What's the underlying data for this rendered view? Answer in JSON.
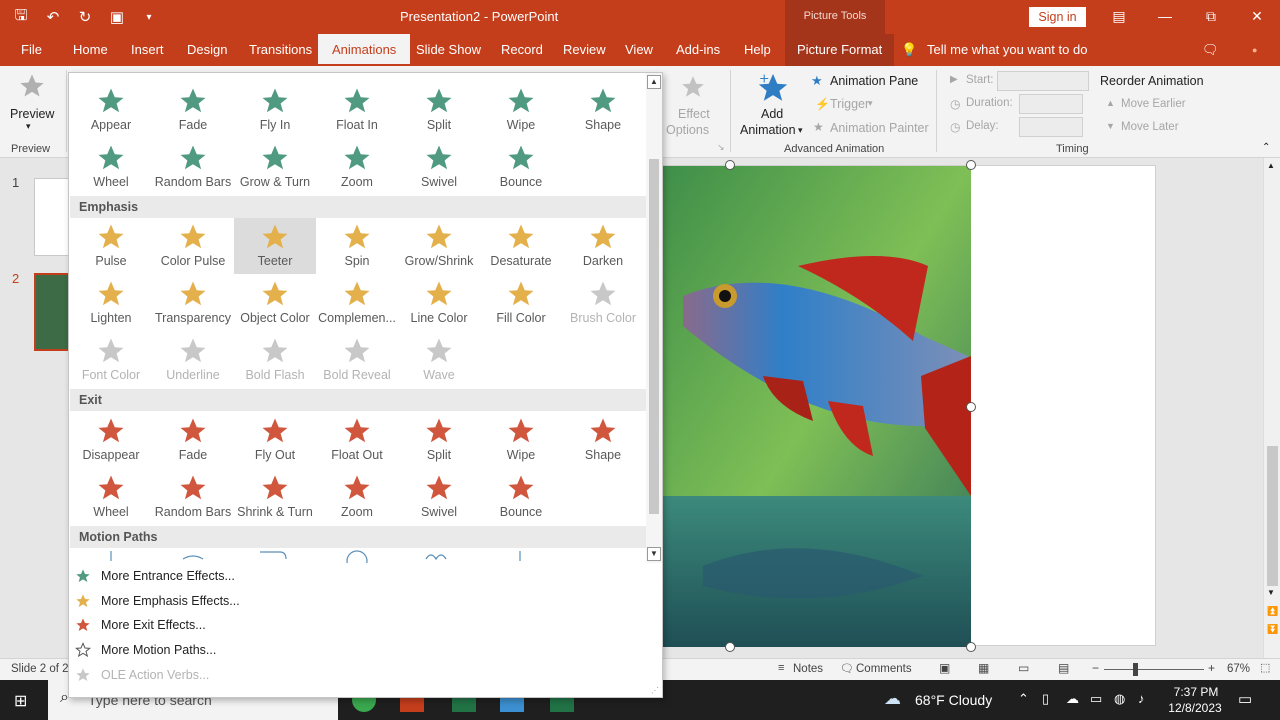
{
  "titlebar": {
    "doc_title": "Presentation2  -  PowerPoint",
    "picture_tools": "Picture Tools",
    "sign_in": "Sign in"
  },
  "tabs": [
    "File",
    "Home",
    "Insert",
    "Design",
    "Transitions",
    "Animations",
    "Slide Show",
    "Record",
    "Review",
    "View",
    "Add-ins",
    "Help",
    "Picture Format"
  ],
  "tell_me": "Tell me what you want to do",
  "ribbon": {
    "preview_label": "Preview",
    "preview_group": "Preview",
    "effect_options_1": "Effect",
    "effect_options_2": "Options",
    "add_animation_1": "Add",
    "add_animation_2": "Animation",
    "animation_pane": "Animation Pane",
    "trigger": "Trigger",
    "animation_painter": "Animation Painter",
    "advanced_group": "Advanced Animation",
    "start": "Start:",
    "duration": "Duration:",
    "delay": "Delay:",
    "timing_group": "Timing",
    "reorder": "Reorder Animation",
    "move_earlier": "Move Earlier",
    "move_later": "Move Later"
  },
  "sections": {
    "emphasis": "Emphasis",
    "exit": "Exit",
    "motion_paths": "Motion Paths"
  },
  "entrance_effects": [
    "Appear",
    "Fade",
    "Fly In",
    "Float In",
    "Split",
    "Wipe",
    "Shape",
    "Wheel",
    "Random Bars",
    "Grow & Turn",
    "Zoom",
    "Swivel",
    "Bounce"
  ],
  "emphasis_effects": [
    "Pulse",
    "Color Pulse",
    "Teeter",
    "Spin",
    "Grow/Shrink",
    "Desaturate",
    "Darken",
    "Lighten",
    "Transparency",
    "Object Color",
    "Complemen...",
    "Line Color",
    "Fill Color",
    "Brush Color",
    "Font Color",
    "Underline",
    "Bold Flash",
    "Bold Reveal",
    "Wave"
  ],
  "exit_effects": [
    "Disappear",
    "Fade",
    "Fly Out",
    "Float Out",
    "Split",
    "Wipe",
    "Shape",
    "Wheel",
    "Random Bars",
    "Shrink & Turn",
    "Zoom",
    "Swivel",
    "Bounce"
  ],
  "more_items": [
    "More Entrance Effects...",
    "More Emphasis Effects...",
    "More Exit Effects...",
    "More Motion Paths...",
    "OLE Action Verbs..."
  ],
  "slides": [
    "1",
    "2"
  ],
  "status": {
    "slide_of": "Slide 2 of 2",
    "notes": "Notes",
    "comments": "Comments",
    "zoom": "67%"
  },
  "taskbar": {
    "search_placeholder": "Type here to search",
    "weather": "68°F  Cloudy",
    "time": "7:37 PM",
    "date": "12/8/2023"
  },
  "colors": {
    "brand": "#c43e1c",
    "entrance": "#4f9a80",
    "emphasis": "#e3b04b",
    "exit": "#d0573d"
  }
}
